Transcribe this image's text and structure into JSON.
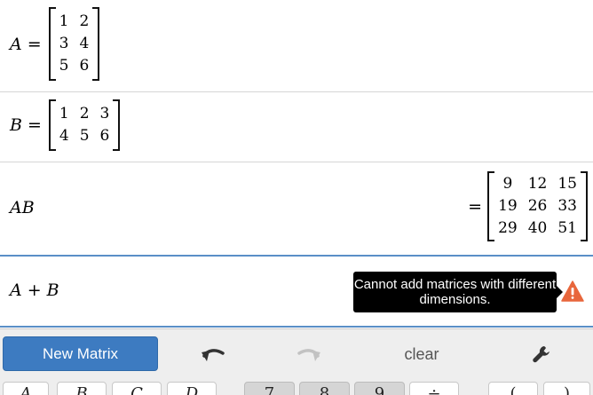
{
  "expressions": [
    {
      "label": "A",
      "eq": "=",
      "matrix": [
        [
          "1",
          "2"
        ],
        [
          "3",
          "4"
        ],
        [
          "5",
          "6"
        ]
      ]
    },
    {
      "label": "B",
      "eq": "=",
      "matrix": [
        [
          "1",
          "2",
          "3"
        ],
        [
          "4",
          "5",
          "6"
        ]
      ]
    },
    {
      "label": "AB",
      "result_eq": "=",
      "result": [
        [
          "9",
          "12",
          "15"
        ],
        [
          "19",
          "26",
          "33"
        ],
        [
          "29",
          "40",
          "51"
        ]
      ]
    },
    {
      "label_left": "A",
      "plus": "+",
      "label_right": "B",
      "error": "Cannot add matrices with different dimensions."
    }
  ],
  "toolbar": {
    "new_matrix_label": "New Matrix",
    "clear_label": "clear",
    "undo_icon": "undo-icon",
    "redo_icon": "redo-icon",
    "settings_icon": "wrench-icon"
  },
  "keypad": {
    "variable_keys": [
      "A",
      "B",
      "C",
      "D"
    ],
    "digit_keys": [
      "7",
      "8",
      "9"
    ],
    "op_keys": [
      "÷",
      "(",
      ")"
    ]
  },
  "colors": {
    "accent": "#3d7bc1",
    "warning": "#e8663c",
    "tooltip_bg": "#000000"
  }
}
